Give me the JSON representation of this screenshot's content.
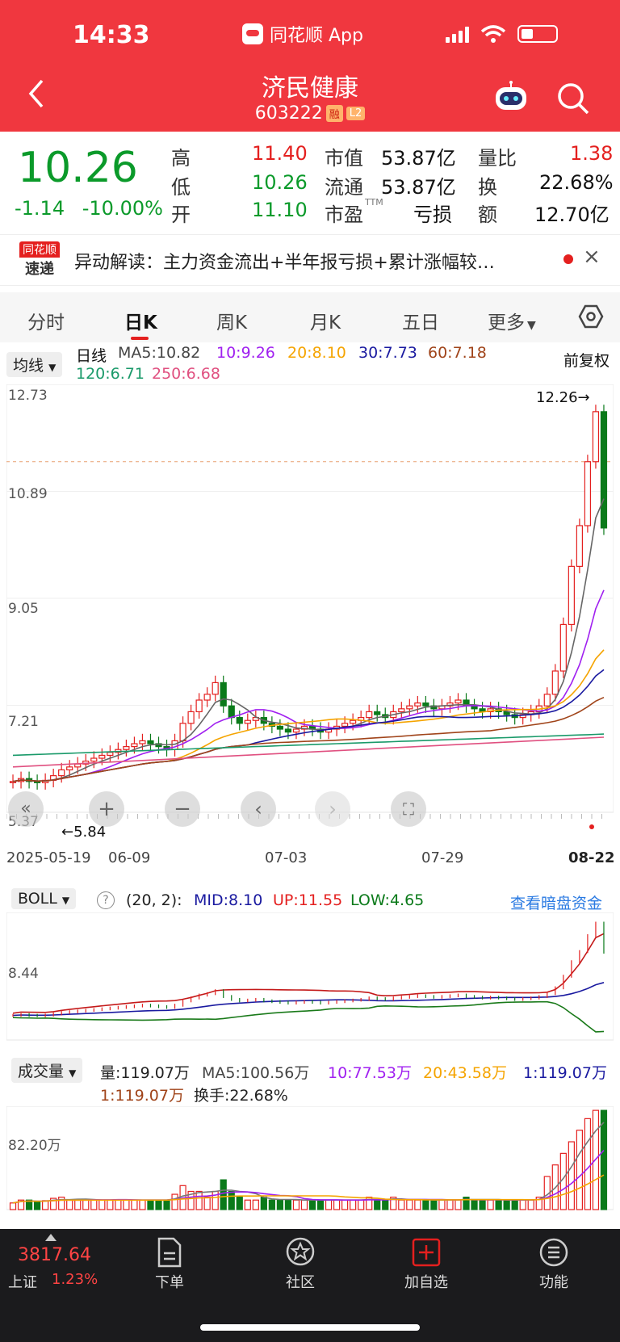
{
  "status_bar": {
    "time": "14:33",
    "app": "同花顺 App"
  },
  "header": {
    "title": "济民健康",
    "code": "603222",
    "badge_margin": "融",
    "badge_level": "L2"
  },
  "quote": {
    "price": "10.26",
    "change": "-1.14",
    "change_pct": "-10.00%",
    "high_label": "高",
    "high": "11.40",
    "low_label": "低",
    "low": "10.26",
    "open_label": "开",
    "open": "11.10",
    "mktcap_label": "市值",
    "mktcap": "53.87亿",
    "float_label": "流通",
    "float_cap": "53.87亿",
    "pe_label": "市盈",
    "pe_sup": "TTM",
    "pe": "亏损",
    "vol_ratio_label": "量比",
    "vol_ratio": "1.38",
    "turnover_label": "换",
    "turnover": "22.68%",
    "amount_label": "额",
    "amount": "12.70亿"
  },
  "news": {
    "logo_top": "同花顺",
    "logo_bottom": "速递",
    "text": "异动解读：主力资金流出+半年报亏损+累计涨幅较…",
    "close": "×"
  },
  "tabs": [
    "分时",
    "日K",
    "周K",
    "月K",
    "五日",
    "更多"
  ],
  "kline": {
    "ma_selector": "均线",
    "period": "日线",
    "adjust": "前复权",
    "ma5": "MA5:10.82",
    "ma10": "10:9.26",
    "ma20": "20:8.10",
    "ma30": "30:7.73",
    "ma60": "60:7.18",
    "ma120": "120:6.71",
    "ma250": "250:6.68",
    "y_labels": [
      "12.73",
      "10.89",
      "9.05",
      "7.21",
      "5.37"
    ],
    "high_mark": "12.26→",
    "low_mark": "←5.84",
    "dates": [
      "2025-05-19",
      "06-09",
      "07-03",
      "07-29",
      "08-22"
    ],
    "colors": {
      "ma5": "#666666",
      "ma10": "#a020f0",
      "ma20": "#f5a400",
      "ma30": "#1a1aa0",
      "ma60": "#a0441a",
      "ma120": "#1a9a6a",
      "ma250": "#e05080",
      "up": "#e4201f",
      "down": "#0b7a1a"
    }
  },
  "boll": {
    "selector": "BOLL",
    "help": "?",
    "params": "(20, 2):",
    "mid": "MID:8.10",
    "up": "UP:11.55",
    "low": "LOW:4.65",
    "link": "查看暗盘资金",
    "y_label": "8.44"
  },
  "volume": {
    "selector": "成交量",
    "vol": "量:119.07万",
    "ma5": "MA5:100.56万",
    "ma10": "10:77.53万",
    "ma20": "20:43.58万",
    "ma30": "1:119.07万",
    "ma60": "1:119.07万",
    "turnover": "换手:22.68%",
    "y_label": "82.20万"
  },
  "index": {
    "value": "3817.64",
    "name": "上证",
    "pct": "1.23%"
  },
  "bottom_nav": [
    "下单",
    "社区",
    "加自选",
    "功能"
  ],
  "chart_data": {
    "type": "candlestick",
    "ylim": [
      5.37,
      12.73
    ],
    "x_ticks": [
      "2025-05-19",
      "06-09",
      "07-03",
      "07-29",
      "08-22"
    ],
    "closes": [
      5.9,
      5.95,
      5.9,
      5.88,
      5.92,
      6.0,
      6.1,
      6.15,
      6.2,
      6.25,
      6.3,
      6.35,
      6.4,
      6.45,
      6.5,
      6.55,
      6.6,
      6.55,
      6.5,
      6.45,
      6.6,
      6.9,
      7.1,
      7.3,
      7.4,
      7.6,
      7.2,
      7.0,
      6.9,
      6.95,
      7.0,
      6.9,
      6.85,
      6.8,
      6.75,
      6.8,
      6.85,
      6.8,
      6.75,
      6.8,
      6.85,
      6.9,
      6.95,
      7.0,
      7.1,
      7.05,
      7.0,
      7.1,
      7.15,
      7.2,
      7.25,
      7.2,
      7.15,
      7.2,
      7.25,
      7.3,
      7.2,
      7.15,
      7.1,
      7.15,
      7.1,
      7.05,
      7.0,
      7.05,
      7.1,
      7.2,
      7.4,
      7.8,
      8.6,
      9.6,
      10.3,
      11.4,
      12.26,
      10.26
    ]
  }
}
